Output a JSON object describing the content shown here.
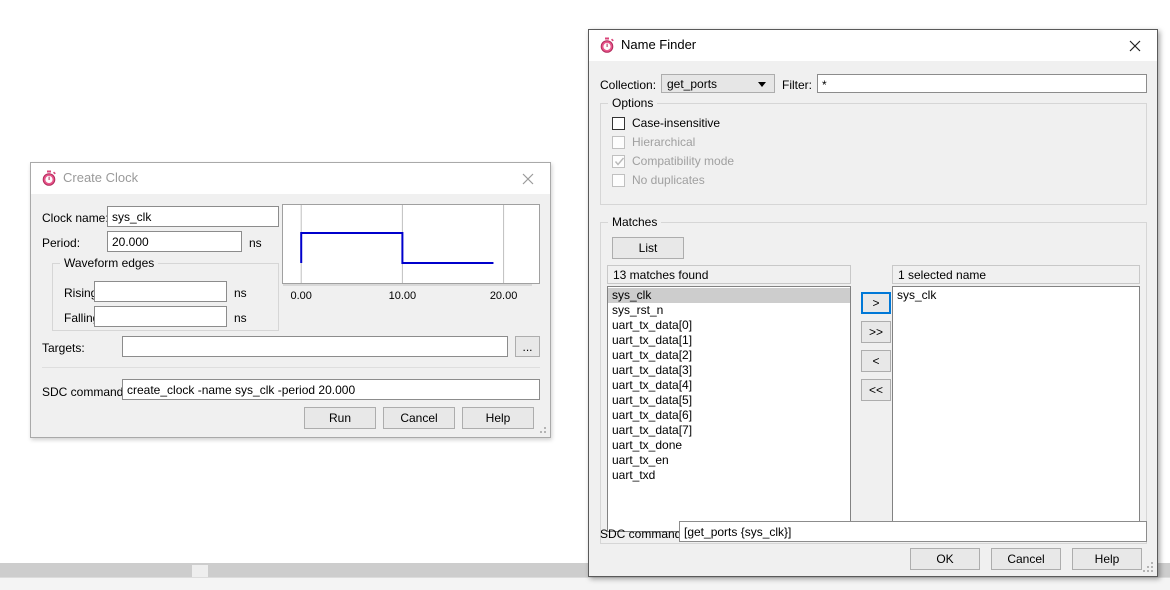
{
  "background": {
    "scrollbar_name": "horizontal-scrollbar"
  },
  "create_clock": {
    "title": "Create Clock",
    "icon": "stopwatch-icon",
    "close_icon": "close-icon",
    "fields": {
      "clock_name_label": "Clock name:",
      "clock_name_value": "sys_clk",
      "period_label": "Period:",
      "period_value": "20.000",
      "period_unit": "ns",
      "waveform_group_label": "Waveform edges",
      "rising_label": "Rising:",
      "rising_value": "",
      "rising_unit": "ns",
      "falling_label": "Falling:",
      "falling_value": "",
      "falling_unit": "ns",
      "targets_label": "Targets:",
      "targets_value": "",
      "targets_browse_label": "...",
      "sdc_label": "SDC command:",
      "sdc_value": "create_clock -name sys_clk -period 20.000"
    },
    "buttons": {
      "run": "Run",
      "cancel": "Cancel",
      "help": "Help"
    },
    "chart_data": {
      "type": "line",
      "title": "",
      "xlabel": "",
      "ylabel": "",
      "xlim": [
        -1.8,
        23.5
      ],
      "ylim": [
        0,
        1
      ],
      "grid": true,
      "gridlines_x": [
        0.0,
        10.0,
        20.0
      ],
      "tick_labels": [
        "0.00",
        "10.00",
        "20.00"
      ],
      "series": [
        {
          "name": "sys_clk",
          "color": "#0000cc",
          "x": [
            0.0,
            0.0,
            10.0,
            10.0,
            19.0
          ],
          "y": [
            0,
            1,
            1,
            0,
            0
          ]
        }
      ]
    }
  },
  "name_finder": {
    "title": "Name Finder",
    "icon": "stopwatch-icon",
    "close_icon": "close-icon",
    "collection_label": "Collection:",
    "collection_value": "get_ports",
    "collection_options": [
      "get_ports"
    ],
    "filter_label": "Filter:",
    "filter_value": "*",
    "options_group_label": "Options",
    "options": [
      {
        "label": "Case-insensitive",
        "checked": false,
        "disabled": false
      },
      {
        "label": "Hierarchical",
        "checked": false,
        "disabled": true
      },
      {
        "label": "Compatibility mode",
        "checked": true,
        "disabled": true
      },
      {
        "label": "No duplicates",
        "checked": false,
        "disabled": true
      }
    ],
    "matches_group_label": "Matches",
    "list_button_label": "List",
    "matches_header": "13 matches found",
    "matches": [
      "sys_clk",
      "sys_rst_n",
      "uart_tx_data[0]",
      "uart_tx_data[1]",
      "uart_tx_data[2]",
      "uart_tx_data[3]",
      "uart_tx_data[4]",
      "uart_tx_data[5]",
      "uart_tx_data[6]",
      "uart_tx_data[7]",
      "uart_tx_done",
      "uart_tx_en",
      "uart_txd"
    ],
    "selected_match_index": 0,
    "transfer_buttons": [
      {
        "label": ">",
        "name": "move-right-button",
        "focused": true
      },
      {
        "label": ">>",
        "name": "move-all-right-button",
        "focused": false
      },
      {
        "label": "<",
        "name": "move-left-button",
        "focused": false
      },
      {
        "label": "<<",
        "name": "move-all-left-button",
        "focused": false
      }
    ],
    "selected_header": "1 selected name",
    "selected_names": [
      "sys_clk"
    ],
    "sdc_label": "SDC command:",
    "sdc_value": "[get_ports {sys_clk}]",
    "buttons": {
      "ok": "OK",
      "cancel": "Cancel",
      "help": "Help"
    }
  }
}
